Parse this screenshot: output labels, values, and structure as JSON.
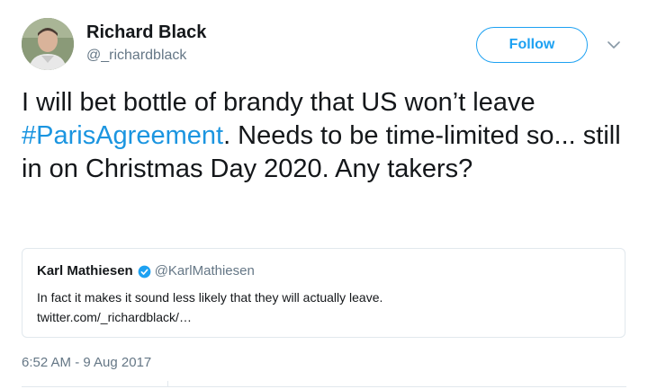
{
  "author": {
    "display_name": "Richard Black",
    "handle": "@_richardblack",
    "avatar_icon": "profile-photo"
  },
  "header": {
    "follow_label": "Follow",
    "more_icon": "chevron-down-icon"
  },
  "tweet": {
    "text_part1": "I will bet bottle of brandy that US won’t leave ",
    "hashtag": "#ParisAgreement",
    "text_part2": ". Needs to be time-limited so... still in on Christmas Day 2020. Any takers?"
  },
  "quote": {
    "name": "Karl Mathiesen",
    "verified_icon": "verified-badge-icon",
    "handle": "@KarlMathiesen",
    "body_line1": "In fact it makes it sound less likely that they will actually leave.",
    "body_line2": "twitter.com/_richardblack/…"
  },
  "timestamp": "6:52 AM - 9 Aug 2017",
  "colors": {
    "accent": "#1da1f2",
    "link": "#1b95e0",
    "secondary_text": "#657786",
    "border": "#e1e8ed"
  }
}
